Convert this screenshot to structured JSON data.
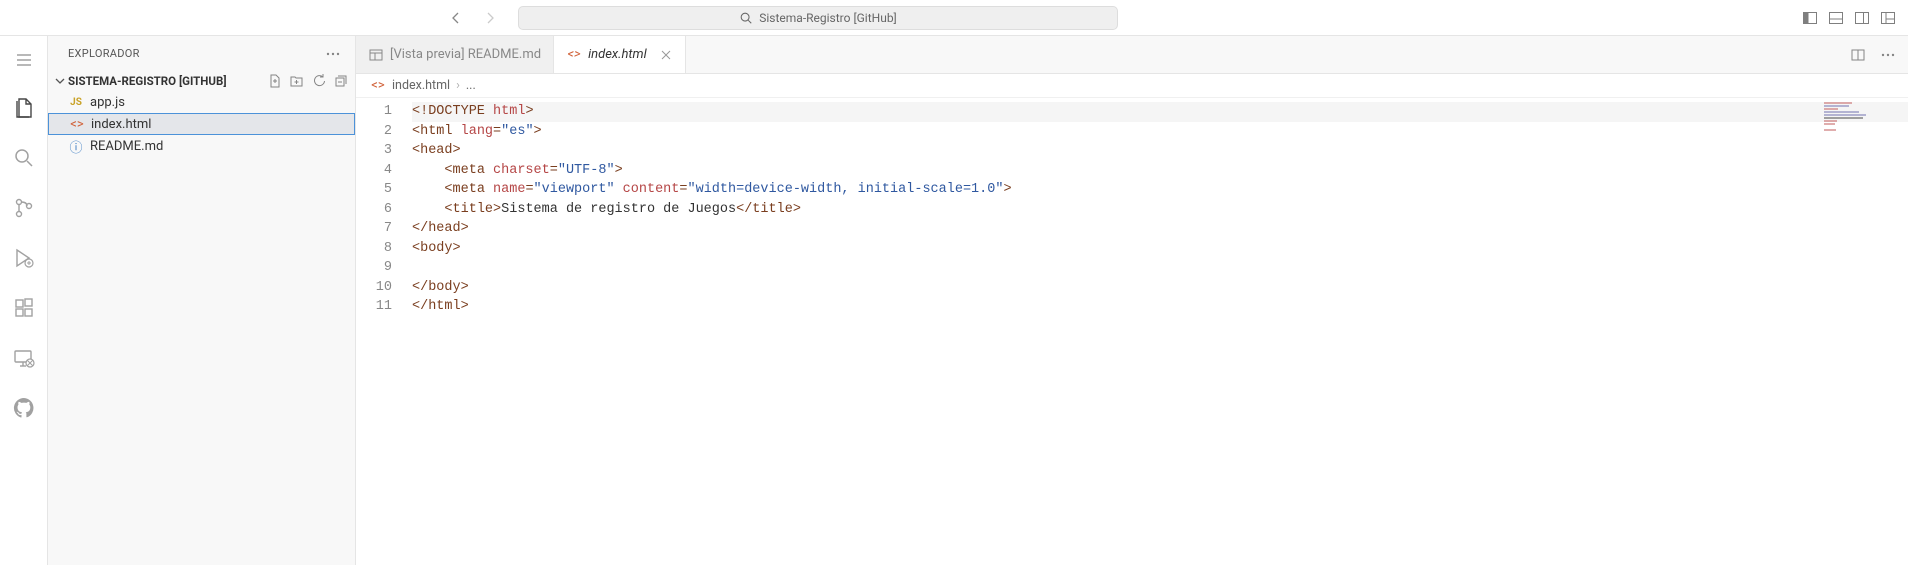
{
  "titlebar": {
    "search_text": "Sistema-Registro [GitHub]"
  },
  "sidebar": {
    "title": "EXPLORADOR",
    "folder_name": "SISTEMA-REGISTRO [GITHUB]",
    "files": [
      {
        "name": "app.js",
        "type": "js"
      },
      {
        "name": "index.html",
        "type": "html"
      },
      {
        "name": "README.md",
        "type": "md"
      }
    ]
  },
  "tabs": [
    {
      "label": "[Vista previa] README.md",
      "icon": "preview",
      "active": false
    },
    {
      "label": "index.html",
      "icon": "html",
      "active": true
    }
  ],
  "breadcrumb": {
    "file": "index.html",
    "rest": "..."
  },
  "code": {
    "lines": [
      {
        "n": 1,
        "html": "<span class='t-punc'>&lt;!</span><span class='t-doctype'>DOCTYPE</span> <span class='t-attr'>html</span><span class='t-punc'>&gt;</span>"
      },
      {
        "n": 2,
        "html": "<span class='t-punc'>&lt;</span><span class='t-tag'>html</span> <span class='t-attr'>lang</span><span class='t-punc'>=</span><span class='t-str'>\"es\"</span><span class='t-punc'>&gt;</span>"
      },
      {
        "n": 3,
        "html": "<span class='t-punc'>&lt;</span><span class='t-tag'>head</span><span class='t-punc'>&gt;</span>"
      },
      {
        "n": 4,
        "html": "    <span class='t-punc'>&lt;</span><span class='t-tag'>meta</span> <span class='t-attr'>charset</span><span class='t-punc'>=</span><span class='t-str'>\"UTF-8\"</span><span class='t-punc'>&gt;</span>"
      },
      {
        "n": 5,
        "html": "    <span class='t-punc'>&lt;</span><span class='t-tag'>meta</span> <span class='t-attr'>name</span><span class='t-punc'>=</span><span class='t-str'>\"viewport\"</span> <span class='t-attr'>content</span><span class='t-punc'>=</span><span class='t-str'>\"width=device-width, initial-scale=1.0\"</span><span class='t-punc'>&gt;</span>"
      },
      {
        "n": 6,
        "html": "    <span class='t-punc'>&lt;</span><span class='t-tag'>title</span><span class='t-punc'>&gt;</span><span class='t-txt'>Sistema de registro de Juegos</span><span class='t-punc'>&lt;/</span><span class='t-tag'>title</span><span class='t-punc'>&gt;</span>"
      },
      {
        "n": 7,
        "html": "<span class='t-punc'>&lt;/</span><span class='t-tag'>head</span><span class='t-punc'>&gt;</span>"
      },
      {
        "n": 8,
        "html": "<span class='t-punc'>&lt;</span><span class='t-tag'>body</span><span class='t-punc'>&gt;</span>"
      },
      {
        "n": 9,
        "html": ""
      },
      {
        "n": 10,
        "html": "<span class='t-punc'>&lt;/</span><span class='t-tag'>body</span><span class='t-punc'>&gt;</span>"
      },
      {
        "n": 11,
        "html": "<span class='t-punc'>&lt;/</span><span class='t-tag'>html</span><span class='t-punc'>&gt;</span>"
      }
    ],
    "current_line": 1
  }
}
